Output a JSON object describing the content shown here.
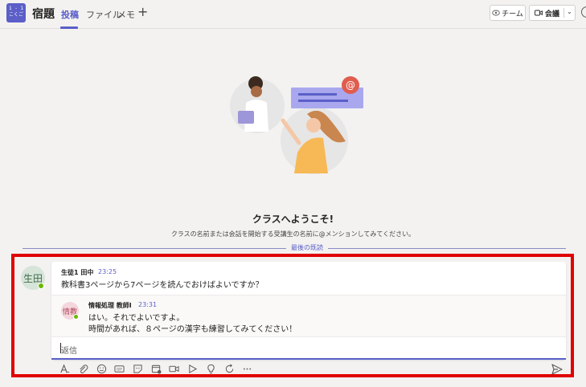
{
  "header": {
    "team_avatar_line1": "1 - 1",
    "team_avatar_line2": "こくご",
    "channel": "宿題",
    "tabs": [
      {
        "label": "投稿",
        "active": true
      },
      {
        "label": "ファイル",
        "active": false
      },
      {
        "label": "メモ",
        "active": false
      }
    ],
    "team_button": "チーム",
    "meet_button": "会議"
  },
  "welcome": {
    "title": "クラスへようこそ!",
    "subtitle": "クラスの名前または会話を開始する受講生の名前に@メンションしてみてください。"
  },
  "last_read_label": "最後の既読",
  "thread": {
    "avatar": "生田",
    "author": "生徒1 田中",
    "time": "23:25",
    "text": "教科書3ページから7ページを読んでおけばよいですか？",
    "reply": {
      "avatar": "情教",
      "author": "情報処理 教師I",
      "time": "23:31",
      "line1": "はい。それでよいですよ。",
      "line2": "時間があれば、８ページの漢字も練習してみてください！"
    },
    "reply_placeholder": "返信"
  },
  "colors": {
    "accent": "#5b5fc7",
    "highlight": "#e00000",
    "presence": "#6bb700"
  }
}
